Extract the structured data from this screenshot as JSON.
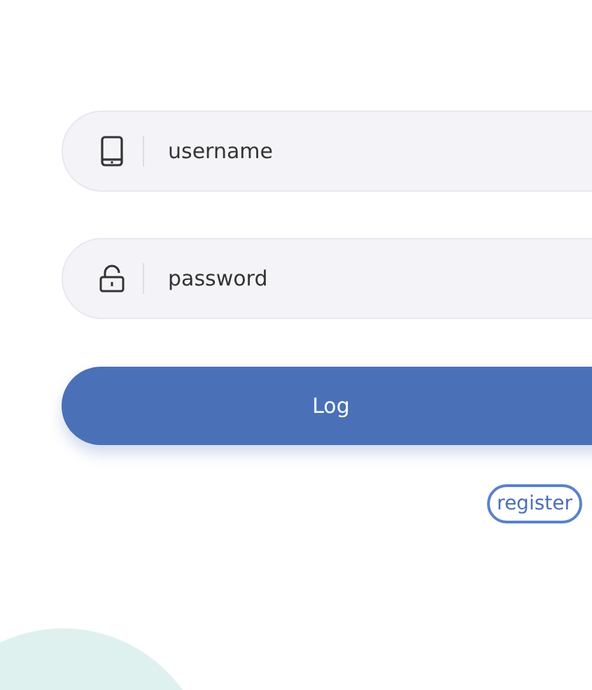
{
  "fields": [
    {
      "kind": "phone",
      "placeholder": "username"
    },
    {
      "kind": "lock",
      "placeholder": "password"
    }
  ],
  "login_button": {
    "label": "Log"
  },
  "register_link": {
    "label": "register"
  }
}
